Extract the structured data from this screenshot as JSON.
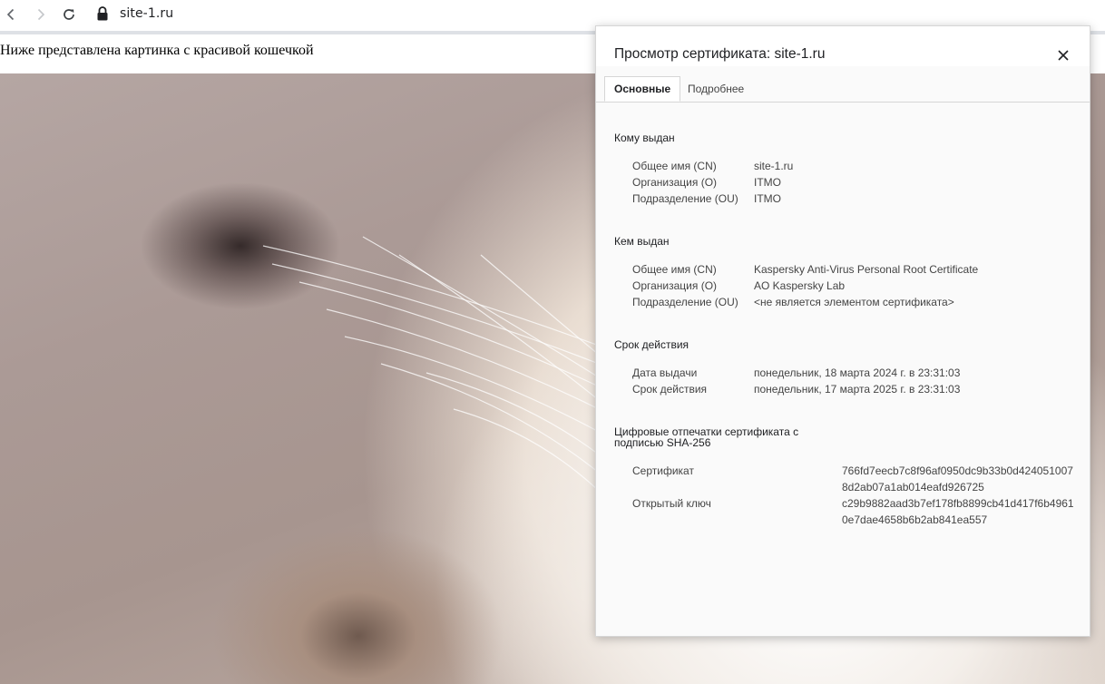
{
  "browser": {
    "url": "site-1.ru"
  },
  "page": {
    "text": "Ниже представлена картинка с красивой кошечкой"
  },
  "dialog": {
    "title": "Просмотр сертификата: site-1.ru",
    "tabs": [
      {
        "label": "Основные",
        "active": true
      },
      {
        "label": "Подробнее",
        "active": false
      }
    ],
    "issued_to": {
      "title": "Кому выдан",
      "rows": [
        {
          "label": "Общее имя (CN)",
          "value": "site-1.ru"
        },
        {
          "label": "Организация (O)",
          "value": "ITMO"
        },
        {
          "label": "Подразделение (OU)",
          "value": "ITMO"
        }
      ]
    },
    "issued_by": {
      "title": "Кем выдан",
      "rows": [
        {
          "label": "Общее имя (CN)",
          "value": "Kaspersky Anti-Virus Personal Root Certificate"
        },
        {
          "label": "Организация (O)",
          "value": "AO Kaspersky Lab"
        },
        {
          "label": "Подразделение (OU)",
          "value": "<не является элементом сертификата>"
        }
      ]
    },
    "validity": {
      "title": "Срок действия",
      "rows": [
        {
          "label": "Дата выдачи",
          "value": "понедельник, 18 марта 2024 г. в 23:31:03"
        },
        {
          "label": "Срок действия",
          "value": "понедельник, 17 марта 2025 г. в 23:31:03"
        }
      ]
    },
    "fingerprints": {
      "title_line1": "Цифровые отпечатки сертификата с",
      "title_line2": "подписью SHA-256",
      "rows": [
        {
          "label": "Сертификат",
          "value": "766fd7eecb7c8f96af0950dc9b33b0d4240510078d2ab07a1ab014eafd926725"
        },
        {
          "label": "Открытый ключ",
          "value": "c29b9882aad3b7ef178fb8899cb41d417f6b49610e7dae4658b6b2ab841ea557"
        }
      ]
    }
  },
  "icons": {
    "back": "arrow-left-icon",
    "forward": "arrow-right-icon",
    "reload": "reload-icon",
    "lock": "lock-icon",
    "close": "close-icon"
  }
}
